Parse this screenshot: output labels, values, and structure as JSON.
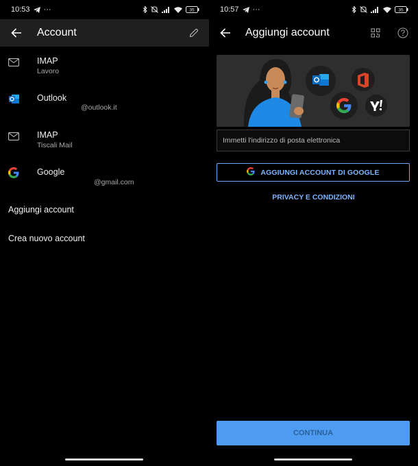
{
  "left": {
    "status": {
      "time": "10:53",
      "dots": "···",
      "battery": "35"
    },
    "appbar": {
      "title": "Account"
    },
    "accounts": [
      {
        "type": "IMAP",
        "detail": "Lavoro",
        "icon": "mail-icon"
      },
      {
        "type": "Outlook",
        "detail": "@outlook.it",
        "icon": "outlook-icon"
      },
      {
        "type": "IMAP",
        "detail": "Tiscali Mail",
        "icon": "mail-icon"
      },
      {
        "type": "Google",
        "detail": "@gmail.com",
        "icon": "google-icon"
      }
    ],
    "add_account": "Aggiungi account",
    "create_account": "Crea nuovo account"
  },
  "right": {
    "status": {
      "time": "10:57",
      "dots": "···",
      "battery": "35"
    },
    "appbar": {
      "title": "Aggiungi account"
    },
    "email": {
      "placeholder": "Immetti l'indirizzo di posta elettronica",
      "value": ""
    },
    "google_button": "AGGIUNGI ACCOUNT DI GOOGLE",
    "privacy": "PRIVACY E CONDIZIONI",
    "continue": "CONTINUA"
  },
  "colors": {
    "accent": "#7db4ff",
    "continue_bg": "#4d9cf2",
    "appbar_bg": "#1f1f1f",
    "outlook_blue": "#0f6cbd",
    "office_red": "#d9452b"
  }
}
